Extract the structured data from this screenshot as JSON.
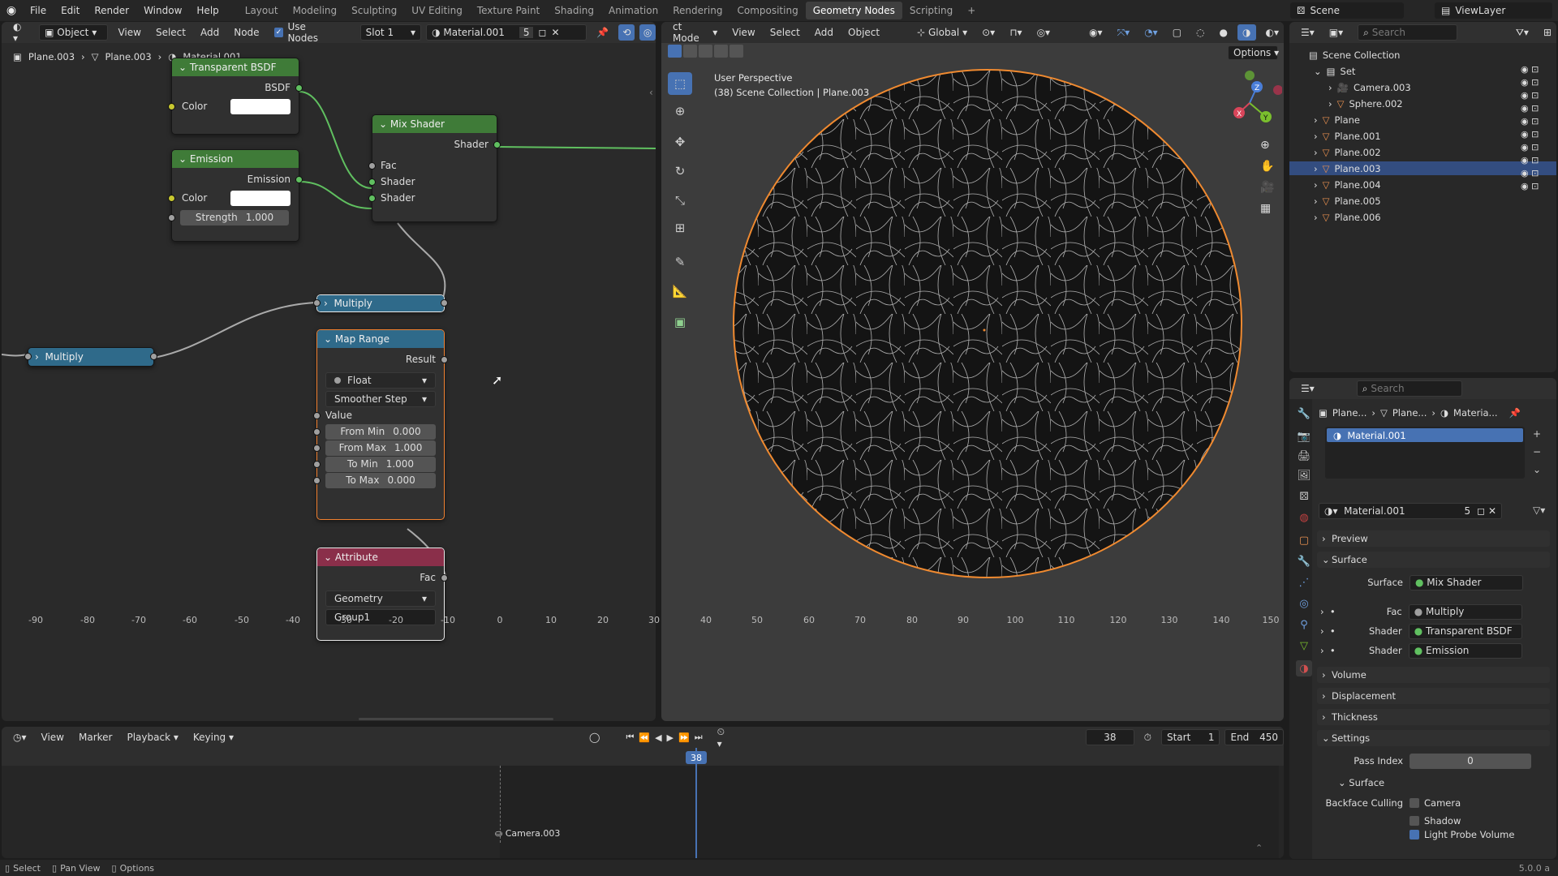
{
  "menu": [
    "File",
    "Edit",
    "Render",
    "Window",
    "Help"
  ],
  "workspaces": [
    "Layout",
    "Modeling",
    "Sculpting",
    "UV Editing",
    "Texture Paint",
    "Shading",
    "Animation",
    "Rendering",
    "Compositing",
    "Geometry Nodes",
    "Scripting"
  ],
  "active_workspace": "Geometry Nodes",
  "scene": {
    "label": "Scene",
    "view_layer": "ViewLayer"
  },
  "node_editor": {
    "mode": "Object",
    "menus": [
      "View",
      "Select",
      "Add",
      "Node"
    ],
    "use_nodes": "Use Nodes",
    "slot": "Slot 1",
    "material": "Material.001",
    "users": "5",
    "breadcrumb": [
      "Plane.003",
      "Plane.003",
      "Material.001"
    ],
    "nodes": {
      "transparent": {
        "title": "Transparent BSDF",
        "out": "BSDF",
        "color": "Color"
      },
      "emission": {
        "title": "Emission",
        "out": "Emission",
        "color": "Color",
        "strength_label": "Strength",
        "strength": "1.000"
      },
      "mix": {
        "title": "Mix Shader",
        "out": "Shader",
        "fac": "Fac",
        "shader1": "Shader",
        "shader2": "Shader"
      },
      "multiply1": {
        "title": "Multiply"
      },
      "multiply2": {
        "title": "Multiply"
      },
      "maprange": {
        "title": "Map Range",
        "out": "Result",
        "type": "Float",
        "interp": "Smoother Step",
        "value": "Value",
        "fields": [
          {
            "label": "From Min",
            "value": "0.000"
          },
          {
            "label": "From Max",
            "value": "1.000"
          },
          {
            "label": "To Min",
            "value": "1.000"
          },
          {
            "label": "To Max",
            "value": "0.000"
          }
        ]
      },
      "attribute": {
        "title": "Attribute",
        "out": "Fac",
        "type": "Geometry",
        "name": "Group1"
      }
    }
  },
  "viewport": {
    "mode": "ct Mode",
    "menus": [
      "View",
      "Select",
      "Add",
      "Object"
    ],
    "transform": "Global",
    "options": "Options",
    "perspective": "User Perspective",
    "collection_info": "(38) Scene Collection | Plane.003",
    "gizmo": {
      "x": "X",
      "y": "Y",
      "z": "Z"
    }
  },
  "outliner": {
    "search_placeholder": "Search",
    "root": "Scene Collection",
    "items": [
      {
        "name": "Set",
        "indent": 1
      },
      {
        "name": "Camera.003",
        "indent": 2
      },
      {
        "name": "Sphere.002",
        "indent": 2
      },
      {
        "name": "Plane",
        "indent": 1
      },
      {
        "name": "Plane.001",
        "indent": 1
      },
      {
        "name": "Plane.002",
        "indent": 1
      },
      {
        "name": "Plane.003",
        "indent": 1,
        "selected": true
      },
      {
        "name": "Plane.004",
        "indent": 1
      },
      {
        "name": "Plane.005",
        "indent": 1
      },
      {
        "name": "Plane.006",
        "indent": 1
      }
    ]
  },
  "properties": {
    "search_placeholder": "Search",
    "breadcrumb": [
      "Plane...",
      "Plane...",
      "Materia..."
    ],
    "slot": "Material.001",
    "material": "Material.001",
    "users": "5",
    "panels": {
      "preview": "Preview",
      "surface": "Surface",
      "volume": "Volume",
      "displacement": "Displacement",
      "thickness": "Thickness",
      "settings": "Settings"
    },
    "surface_rows": [
      {
        "label": "Surface",
        "value": "Mix Shader"
      },
      {
        "label": "Fac",
        "value": "Multiply"
      },
      {
        "label": "Shader",
        "value": "Transparent BSDF"
      },
      {
        "label": "Shader",
        "value": "Emission"
      }
    ],
    "pass_index_label": "Pass Index",
    "pass_index": "0",
    "sub_surface": "Surface",
    "backface": "Backface Culling",
    "camera": "Camera",
    "shadow": "Shadow",
    "lightprobe": "Light Probe Volume"
  },
  "timeline": {
    "menus": [
      "View",
      "Marker",
      "Playback",
      "Keying"
    ],
    "current_frame": "38",
    "start_label": "Start",
    "start": "1",
    "end_label": "End",
    "end": "450",
    "ticks": [
      "-90",
      "-80",
      "-70",
      "-60",
      "-50",
      "-40",
      "-30",
      "-20",
      "-10",
      "0",
      "10",
      "20",
      "30",
      "40",
      "50",
      "60",
      "70",
      "80",
      "90",
      "100",
      "110",
      "120",
      "130",
      "140",
      "150"
    ],
    "marker": "Camera.003"
  },
  "status": {
    "select": "Select",
    "pan": "Pan View",
    "options": "Options",
    "version": "5.0.0 a"
  },
  "colors": {
    "accent": "#4772b3",
    "selected_orange": "#f08030",
    "shader_green": "#3f7b38",
    "converter_blue": "#2f6a8a",
    "input_red": "#8a2f4a"
  }
}
